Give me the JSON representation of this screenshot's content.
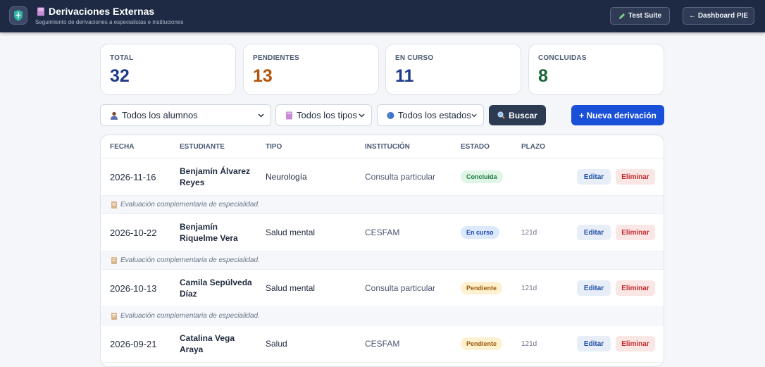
{
  "header": {
    "title": "Derivaciones Externas",
    "subtitle": "Seguimiento de derivaciones a especialistas e instituciones",
    "test_suite_label": "Test Suite",
    "dashboard_label": "← Dashboard PIE"
  },
  "stats": [
    {
      "label": "TOTAL",
      "value": "32",
      "color": "#1e3a8a"
    },
    {
      "label": "PENDIENTES",
      "value": "13",
      "color": "#b45309"
    },
    {
      "label": "EN CURSO",
      "value": "11",
      "color": "#1e3a8a"
    },
    {
      "label": "CONCLUIDAS",
      "value": "8",
      "color": "#166534"
    }
  ],
  "filters": {
    "alumnos": "Todos los alumnos",
    "tipos": "Todos los tipos",
    "estados": "Todos los estados",
    "buscar": "Buscar",
    "nueva": "+ Nueva derivación"
  },
  "table": {
    "headers": [
      "FECHA",
      "ESTUDIANTE",
      "TIPO",
      "INSTITUCIÓN",
      "ESTADO",
      "PLAZO"
    ],
    "rows": [
      {
        "fecha": "2026-11-16",
        "estudiante": "Benjamín Álvarez Reyes",
        "tipo": "Neurología",
        "institucion": "Consulta particular",
        "estado": "Concluida",
        "plazo": "",
        "nota": "Evaluación complementaria de especialidad."
      },
      {
        "fecha": "2026-10-22",
        "estudiante": "Benjamín Riquelme Vera",
        "tipo": "Salud mental",
        "institucion": "CESFAM",
        "estado": "En curso",
        "plazo": "121d",
        "nota": "Evaluación complementaria de especialidad."
      },
      {
        "fecha": "2026-10-13",
        "estudiante": "Camila Sepúlveda Díaz",
        "tipo": "Salud mental",
        "institucion": "Consulta particular",
        "estado": "Pendiente",
        "plazo": "121d",
        "nota": "Evaluación complementaria de especialidad."
      },
      {
        "fecha": "2026-09-21",
        "estudiante": "Catalina Vega Araya",
        "tipo": "Salud",
        "institucion": "CESFAM",
        "estado": "Pendiente",
        "plazo": "121d",
        "nota": ""
      }
    ],
    "edit_label": "Editar",
    "delete_label": "Eliminar"
  },
  "icons": {
    "logo": "shield-icon",
    "title": "book-icon",
    "test_suite": "pencil-icon",
    "alumnos": "person-icon",
    "tipos": "book-icon",
    "estados": "globe-icon",
    "buscar": "search-icon",
    "nota": "clipboard-icon"
  }
}
